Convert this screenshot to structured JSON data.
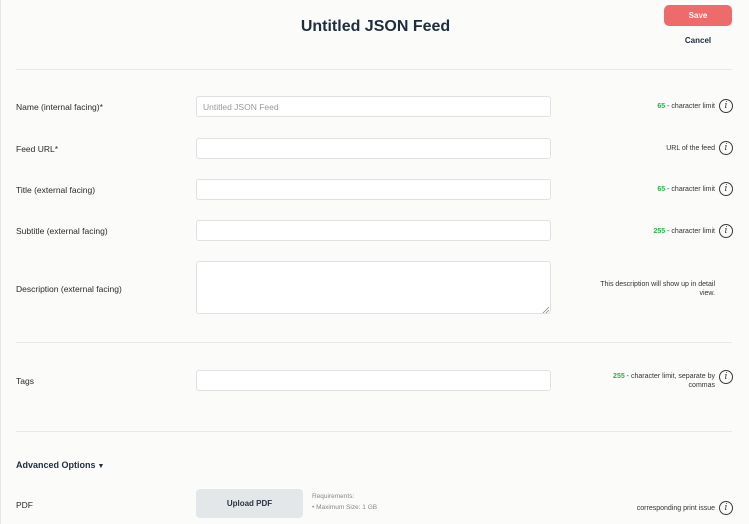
{
  "header": {
    "title": "Untitled JSON Feed",
    "save_label": "Save",
    "cancel_label": "Cancel"
  },
  "fields": {
    "name": {
      "label": "Name (internal facing)*",
      "placeholder": "Untitled JSON Feed",
      "value": "",
      "hint_count": "65",
      "hint_text": " - character limit"
    },
    "feed_url": {
      "label": "Feed URL*",
      "value": "",
      "hint_text": "URL of the feed"
    },
    "title": {
      "label": "Title (external facing)",
      "value": "",
      "hint_count": "65",
      "hint_text": " - character limit"
    },
    "subtitle": {
      "label": "Subtitle (external facing)",
      "value": "",
      "hint_count": "255",
      "hint_text": " - character limit"
    },
    "description": {
      "label": "Description (external facing)",
      "value": "",
      "hint_line1": "This description will show up in detail",
      "hint_line2": "view."
    },
    "tags": {
      "label": "Tags",
      "value": "",
      "hint_count": "255",
      "hint_text": " - character limit, separate by",
      "hint_line2": "commas"
    }
  },
  "advanced": {
    "toggle_label": "Advanced Options",
    "pdf": {
      "label": "PDF",
      "upload_label": "Upload PDF",
      "req_title": "Requirements:",
      "req_item": "• Maximum Size: 1 GB",
      "hint_text": "corresponding print issue"
    }
  },
  "icons": {
    "info": "i",
    "caret": "▼"
  },
  "colors": {
    "save": "#ef6b6b",
    "count": "#2fae4a",
    "title": "#1f2d3d"
  }
}
